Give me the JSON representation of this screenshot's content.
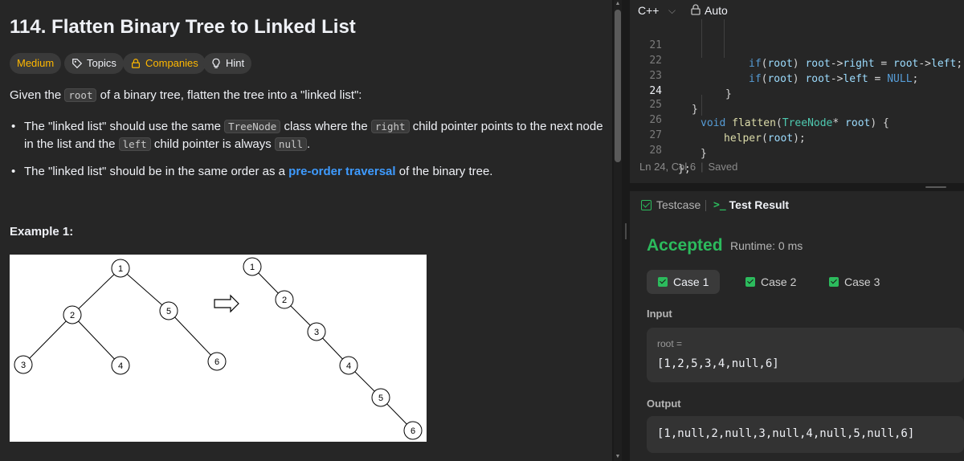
{
  "problem": {
    "title": "114. Flatten Binary Tree to Linked List",
    "tags": {
      "difficulty": "Medium",
      "topics": "Topics",
      "companies": "Companies",
      "hint": "Hint"
    },
    "intro": {
      "before": "Given the ",
      "code": "root",
      "after": " of a binary tree, flatten the tree into a \"linked list\":"
    },
    "bullet1": {
      "p1": "The \"linked list\" should use the same ",
      "c1": "TreeNode",
      "p2": " class where the ",
      "c2": "right",
      "p3": " child pointer points to the next node",
      "p4": "in the list and the ",
      "c3": "left",
      "p5": " child pointer is always ",
      "c4": "null",
      "p6": "."
    },
    "bullet2": {
      "p1": "The \"linked list\" should be in the same order as a ",
      "link": "pre-order traversal",
      "p2": " of the binary tree."
    },
    "example_title": "Example 1:",
    "tree_nodes": [
      "1",
      "2",
      "5",
      "3",
      "4",
      "6"
    ],
    "list_nodes": [
      "1",
      "2",
      "3",
      "4",
      "5",
      "6"
    ]
  },
  "editor": {
    "language": "C++",
    "mode": "Auto",
    "lines": [
      {
        "n": "21",
        "text": "if(root) root->right = root->left;"
      },
      {
        "n": "22",
        "text": "if(root) root->left = NULL;"
      },
      {
        "n": "23",
        "text": "}"
      },
      {
        "n": "24",
        "text": "}"
      },
      {
        "n": "25",
        "text": "void flatten(TreeNode* root) {"
      },
      {
        "n": "26",
        "text": "helper(root);"
      },
      {
        "n": "27",
        "text": "}"
      },
      {
        "n": "28",
        "text": "};"
      }
    ],
    "status_position": "Ln 24, Col 6",
    "status_saved": "Saved"
  },
  "result": {
    "tab_testcase": "Testcase",
    "tab_result": "Test Result",
    "verdict": "Accepted",
    "runtime": "Runtime: 0 ms",
    "cases": [
      "Case 1",
      "Case 2",
      "Case 3"
    ],
    "input_label": "Input",
    "input_var": "root =",
    "input_value": "[1,2,5,3,4,null,6]",
    "output_label": "Output",
    "output_value": "[1,null,2,null,3,null,4,null,5,null,6]"
  },
  "colors": {
    "accent_green": "#2cbb5d",
    "difficulty_medium": "#ffb800",
    "link_blue": "#3e9bff"
  }
}
